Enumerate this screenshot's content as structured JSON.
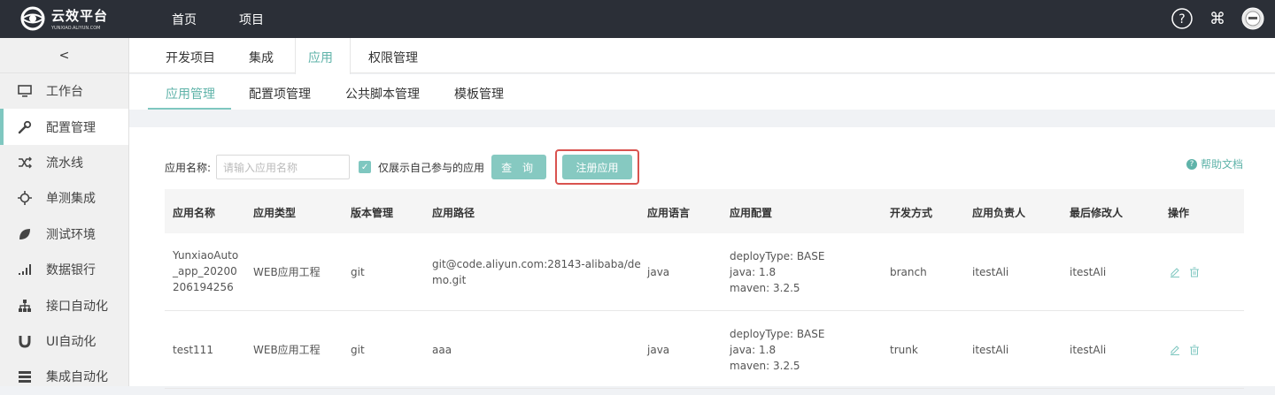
{
  "topbar": {
    "logo_cn": "云效平台",
    "logo_en": "YUNXIAO.ALIYUN.COM",
    "nav": [
      "首页",
      "项目"
    ],
    "icons": [
      "help-circle-icon",
      "command-icon",
      "user-avatar-icon"
    ]
  },
  "sidebar": {
    "collapse_label": "<",
    "items": [
      {
        "label": "工作台",
        "icon": "monitor-icon"
      },
      {
        "label": "配置管理",
        "icon": "wrench-icon"
      },
      {
        "label": "流水线",
        "icon": "shuffle-icon"
      },
      {
        "label": "单测集成",
        "icon": "crosshair-icon"
      },
      {
        "label": "测试环境",
        "icon": "leaf-icon"
      },
      {
        "label": "数据银行",
        "icon": "signal-bars-icon"
      },
      {
        "label": "接口自动化",
        "icon": "sitemap-icon"
      },
      {
        "label": "UI自动化",
        "icon": "magnet-icon"
      },
      {
        "label": "集成自动化",
        "icon": "server-icon"
      }
    ],
    "active": "配置管理"
  },
  "tabs_primary": [
    "开发项目",
    "集成",
    "应用",
    "权限管理"
  ],
  "tabs_primary_active": "应用",
  "tabs_secondary": [
    "应用管理",
    "配置项管理",
    "公共脚本管理",
    "模板管理"
  ],
  "tabs_secondary_active": "应用管理",
  "filter": {
    "name_label": "应用名称:",
    "name_placeholder": "请输入应用名称",
    "only_mine_label": "仅展示自己参与的应用",
    "only_mine_checked": true,
    "query_label": "查 询",
    "register_label": "注册应用"
  },
  "help_label": "帮助文档",
  "table": {
    "columns": [
      "应用名称",
      "应用类型",
      "版本管理",
      "应用路径",
      "应用语言",
      "应用配置",
      "开发方式",
      "应用负责人",
      "最后修改人",
      "操作"
    ],
    "rows": [
      {
        "name": [
          "YunxiaoAuto",
          "_app_20200",
          "206194256"
        ],
        "type": "WEB应用工程",
        "vcs": "git",
        "path": [
          "git@code.aliyun.com:28143-alibaba/de",
          "mo.git"
        ],
        "lang": "java",
        "config": [
          "deployType: BASE",
          "java: 1.8",
          "maven: 3.2.5"
        ],
        "dev_mode": "branch",
        "owner": "itestAli",
        "modifier": "itestAli"
      },
      {
        "name": [
          "test111"
        ],
        "type": "WEB应用工程",
        "vcs": "git",
        "path": [
          "aaa"
        ],
        "lang": "java",
        "config": [
          "deployType: BASE",
          "java: 1.8",
          "maven: 3.2.5"
        ],
        "dev_mode": "trunk",
        "owner": "itestAli",
        "modifier": "itestAli"
      }
    ]
  },
  "colors": {
    "topbar": "#2b2f37",
    "accent": "#5fb3a9",
    "button": "#86c9c1",
    "highlight_border": "#d9534f"
  }
}
